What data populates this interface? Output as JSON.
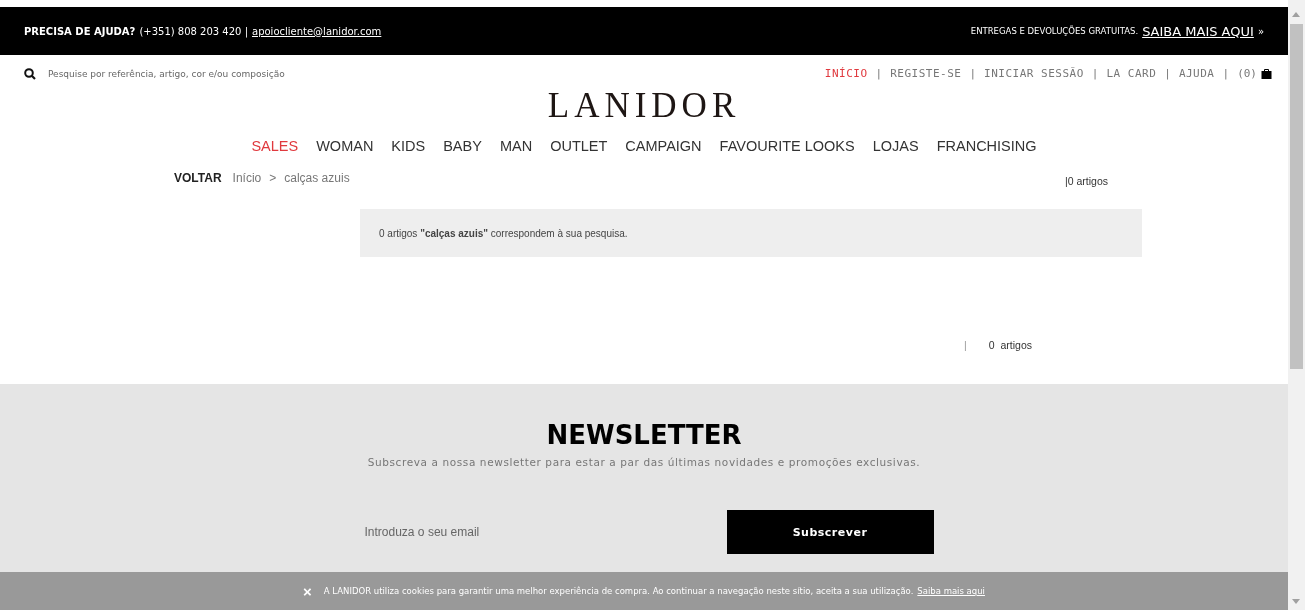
{
  "top_bar": {
    "help_label": "PRECISA DE AJUDA?",
    "phone": "(+351) 808 203 420 |",
    "email": "apoiocliente@lanidor.com",
    "shipping": "ENTREGAS E DEVOLUÇÕES GRATUITAS.",
    "shipping_link": "SAIBA MAIS AQUI",
    "chevron": "»"
  },
  "search": {
    "placeholder": "Pesquise por referência, artigo, cor e/ou composição"
  },
  "user_nav": [
    {
      "kind": "link",
      "label": "INÍCIO",
      "selected": true
    },
    {
      "kind": "separator",
      "label": "|"
    },
    {
      "kind": "link",
      "label": "REGISTE-SE",
      "selected": false
    },
    {
      "kind": "separator",
      "label": "|"
    },
    {
      "kind": "link",
      "label": "INICIAR SESSÃO",
      "selected": false
    },
    {
      "kind": "separator",
      "label": "|"
    },
    {
      "kind": "link",
      "label": "LA CARD",
      "selected": false
    },
    {
      "kind": "separator",
      "label": "|"
    },
    {
      "kind": "link",
      "label": "AJUDA",
      "selected": false
    },
    {
      "kind": "separator",
      "label": "|"
    },
    {
      "kind": "cart",
      "label": "(0)"
    }
  ],
  "logo": "LANIDOR",
  "main_menu": [
    {
      "label": "SALES",
      "highlighted": true
    },
    {
      "label": "WOMAN",
      "highlighted": false
    },
    {
      "label": "KIDS",
      "highlighted": false
    },
    {
      "label": "BABY",
      "highlighted": false
    },
    {
      "label": "MAN",
      "highlighted": false
    },
    {
      "label": "OUTLET",
      "highlighted": false
    },
    {
      "label": "CAMPAIGN",
      "highlighted": false
    },
    {
      "label": "FAVOURITE LOOKS",
      "highlighted": false
    },
    {
      "label": "LOJAS",
      "highlighted": false
    },
    {
      "label": "FRANCHISING",
      "highlighted": false
    }
  ],
  "breadcrumb": {
    "back": "VOLTAR",
    "items": [
      "Início",
      "calças azuis"
    ],
    "separator": ">"
  },
  "count_top": "|0 artigos",
  "message": "0 artigos **\"calças azuis\"** correspondem à sua pesquisa.",
  "count_bottom": {
    "separator": "|",
    "text": "0  artigos"
  },
  "newsletter": {
    "title": "NEWSLETTER",
    "subtitle": "Subscreva a nossa newsletter para estar a par das últimas novidades e promoções exclusivas.",
    "placeholder": "Introduza o seu email",
    "button": "Subscrever"
  },
  "cookie_bar": {
    "close": "×",
    "text": "A LANIDOR utiliza cookies para garantir uma melhor experiência de compra. Ao continuar a navegação neste sítio, aceita a sua utilização.",
    "link": "Saiba mais aqui"
  }
}
